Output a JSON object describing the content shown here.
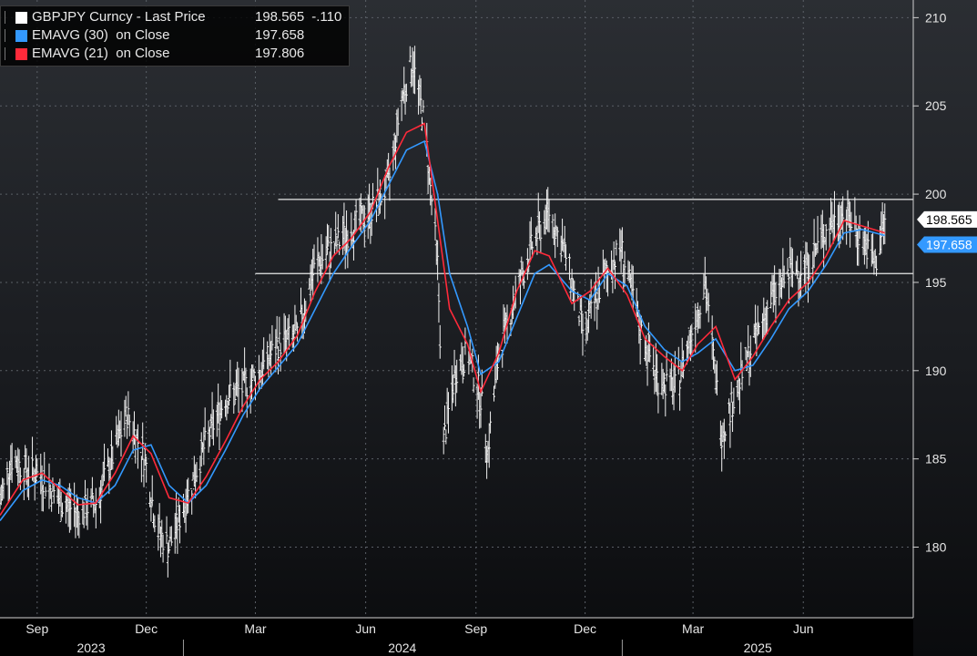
{
  "legend": {
    "items": [
      {
        "name": "GBPJPY Curncy - Last Price",
        "value": "198.565",
        "change": "-.110",
        "color": "#ffffff"
      },
      {
        "name": "EMAVG (30)  on Close",
        "value": "197.658",
        "change": "",
        "color": "#3399ff"
      },
      {
        "name": "EMAVG (21)  on Close",
        "value": "197.806",
        "change": "",
        "color": "#ff2a3a"
      }
    ]
  },
  "chart_data": {
    "type": "line",
    "title": "",
    "xlabel": "",
    "ylabel": "",
    "ylim": [
      176,
      211
    ],
    "y_ticks": [
      180,
      185,
      190,
      195,
      200,
      205,
      210
    ],
    "x_range": [
      "2023-08-01",
      "2025-08-15"
    ],
    "x_ticks": [
      {
        "label": "Sep",
        "date": "2023-09-01"
      },
      {
        "label": "Dec",
        "date": "2023-12-01"
      },
      {
        "label": "Mar",
        "date": "2024-03-01"
      },
      {
        "label": "Jun",
        "date": "2024-06-01"
      },
      {
        "label": "Sep",
        "date": "2024-09-01"
      },
      {
        "label": "Dec",
        "date": "2024-12-01"
      },
      {
        "label": "Mar",
        "date": "2025-03-01"
      },
      {
        "label": "Jun",
        "date": "2025-06-01"
      }
    ],
    "years": [
      {
        "label": "2023",
        "start": "2023-08-01",
        "end": "2023-12-31"
      },
      {
        "label": "2024",
        "start": "2024-01-01",
        "end": "2024-12-31"
      },
      {
        "label": "2025",
        "start": "2025-01-01",
        "end": "2025-08-15"
      }
    ],
    "year_separators": [
      "2024-01-01",
      "2025-01-01"
    ],
    "grid": true,
    "legend_position": "top-left",
    "last_price": "198.565",
    "last_ema30": "197.658",
    "reference_lines": [
      {
        "value": 199.7,
        "start": "2024-03-20",
        "end": "2025-08-15"
      },
      {
        "value": 195.5,
        "start": "2024-03-01",
        "end": "2025-08-15"
      }
    ],
    "series": [
      {
        "name": "GBPJPY Curncy - Last Price",
        "color": "#ffffff",
        "dates": [
          "2023-08-01",
          "2023-08-10",
          "2023-08-20",
          "2023-09-05",
          "2023-09-20",
          "2023-10-05",
          "2023-10-20",
          "2023-11-05",
          "2023-11-15",
          "2023-11-30",
          "2023-12-10",
          "2023-12-20",
          "2024-01-05",
          "2024-01-20",
          "2024-02-05",
          "2024-02-20",
          "2024-03-05",
          "2024-03-20",
          "2024-04-05",
          "2024-04-20",
          "2024-05-05",
          "2024-05-20",
          "2024-06-05",
          "2024-06-20",
          "2024-07-01",
          "2024-07-10",
          "2024-07-20",
          "2024-07-31",
          "2024-08-05",
          "2024-08-15",
          "2024-08-25",
          "2024-09-05",
          "2024-09-11",
          "2024-09-20",
          "2024-10-05",
          "2024-10-20",
          "2024-11-01",
          "2024-11-15",
          "2024-11-30",
          "2024-12-15",
          "2024-12-31",
          "2025-01-15",
          "2025-01-31",
          "2025-02-15",
          "2025-03-01",
          "2025-03-11",
          "2025-03-25",
          "2025-04-07",
          "2025-04-20",
          "2025-05-05",
          "2025-05-20",
          "2025-06-05",
          "2025-06-20",
          "2025-07-05",
          "2025-07-20",
          "2025-07-31",
          "2025-08-08"
        ],
        "values": [
          182.5,
          185.0,
          184.5,
          184.0,
          182.5,
          182.0,
          182.5,
          185.5,
          187.5,
          185.0,
          181.0,
          180.0,
          183.0,
          186.0,
          188.5,
          189.0,
          190.0,
          191.5,
          192.0,
          196.0,
          197.0,
          198.0,
          199.0,
          200.5,
          205.5,
          207.5,
          204.0,
          196.0,
          186.0,
          190.0,
          191.0,
          188.5,
          185.5,
          191.0,
          194.5,
          197.5,
          199.0,
          196.5,
          192.0,
          195.0,
          197.0,
          192.5,
          189.5,
          189.0,
          192.5,
          195.0,
          186.5,
          189.0,
          191.5,
          194.0,
          195.5,
          196.0,
          198.0,
          199.0,
          197.5,
          196.0,
          198.565
        ]
      },
      {
        "name": "EMAVG (30) on Close",
        "color": "#3399ff",
        "dates": [
          "2023-08-01",
          "2023-08-20",
          "2023-09-05",
          "2023-09-20",
          "2023-10-05",
          "2023-10-20",
          "2023-11-05",
          "2023-11-20",
          "2023-12-05",
          "2023-12-20",
          "2024-01-05",
          "2024-01-20",
          "2024-02-05",
          "2024-02-20",
          "2024-03-05",
          "2024-03-20",
          "2024-04-05",
          "2024-04-20",
          "2024-05-05",
          "2024-05-20",
          "2024-06-05",
          "2024-06-20",
          "2024-07-05",
          "2024-07-20",
          "2024-07-31",
          "2024-08-10",
          "2024-08-25",
          "2024-09-05",
          "2024-09-20",
          "2024-10-05",
          "2024-10-20",
          "2024-11-01",
          "2024-11-20",
          "2024-12-05",
          "2024-12-20",
          "2025-01-05",
          "2025-01-20",
          "2025-02-05",
          "2025-02-20",
          "2025-03-05",
          "2025-03-20",
          "2025-04-05",
          "2025-04-20",
          "2025-05-05",
          "2025-05-20",
          "2025-06-05",
          "2025-06-20",
          "2025-07-05",
          "2025-07-20",
          "2025-08-08"
        ],
        "values": [
          181.5,
          183.2,
          183.8,
          183.5,
          182.8,
          182.5,
          183.5,
          185.5,
          185.8,
          183.5,
          182.5,
          183.5,
          185.5,
          187.5,
          189.0,
          190.2,
          191.5,
          193.5,
          195.5,
          197.0,
          198.5,
          200.5,
          202.5,
          203.0,
          200.0,
          195.5,
          192.5,
          189.8,
          190.5,
          193.0,
          195.5,
          196.0,
          194.5,
          194.0,
          195.5,
          194.8,
          192.5,
          191.2,
          190.5,
          191.0,
          191.8,
          190.0,
          190.3,
          191.8,
          193.5,
          194.5,
          196.0,
          197.8,
          198.0,
          197.658
        ]
      },
      {
        "name": "EMAVG (21) on Close",
        "color": "#ff2a3a",
        "dates": [
          "2023-08-01",
          "2023-08-20",
          "2023-09-05",
          "2023-09-20",
          "2023-10-05",
          "2023-10-20",
          "2023-11-05",
          "2023-11-20",
          "2023-12-05",
          "2023-12-20",
          "2024-01-05",
          "2024-01-20",
          "2024-02-05",
          "2024-02-20",
          "2024-03-05",
          "2024-03-20",
          "2024-04-05",
          "2024-04-20",
          "2024-05-05",
          "2024-05-20",
          "2024-06-05",
          "2024-06-20",
          "2024-07-05",
          "2024-07-20",
          "2024-07-31",
          "2024-08-10",
          "2024-08-25",
          "2024-09-05",
          "2024-09-20",
          "2024-10-05",
          "2024-10-20",
          "2024-11-01",
          "2024-11-20",
          "2024-12-05",
          "2024-12-20",
          "2025-01-05",
          "2025-01-20",
          "2025-02-05",
          "2025-02-20",
          "2025-03-05",
          "2025-03-20",
          "2025-04-05",
          "2025-04-20",
          "2025-05-05",
          "2025-05-20",
          "2025-06-05",
          "2025-06-20",
          "2025-07-05",
          "2025-07-20",
          "2025-08-08"
        ],
        "values": [
          181.8,
          183.8,
          184.2,
          183.3,
          182.4,
          182.5,
          184.2,
          186.3,
          185.3,
          182.8,
          182.5,
          184.0,
          186.0,
          188.0,
          189.5,
          190.5,
          192.0,
          194.5,
          196.5,
          197.5,
          199.0,
          201.5,
          203.5,
          204.0,
          198.5,
          193.5,
          191.5,
          188.8,
          191.0,
          194.5,
          196.8,
          196.5,
          193.8,
          194.5,
          195.8,
          194.3,
          191.8,
          190.8,
          190.0,
          191.5,
          192.5,
          189.5,
          190.8,
          192.5,
          194.0,
          195.0,
          196.5,
          198.5,
          198.2,
          197.806
        ]
      }
    ]
  }
}
